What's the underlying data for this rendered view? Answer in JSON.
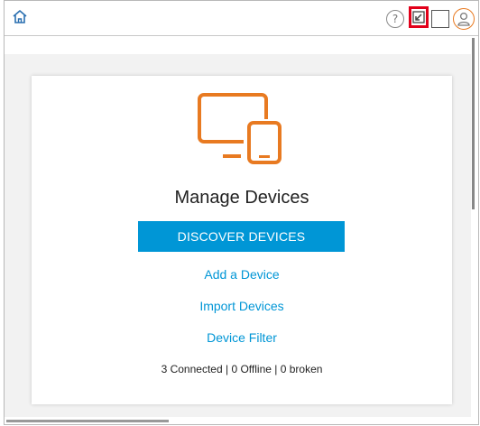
{
  "titlebar": {
    "home_icon": "home-icon",
    "help_label": "?",
    "popout_icon": "popout-icon",
    "window_icon": "window-icon",
    "user_icon": "user-icon",
    "accent_color": "#e87a21",
    "highlight_color": "#e2001a"
  },
  "card": {
    "illustration_icon": "devices-icon",
    "illustration_color": "#e87a21",
    "title": "Manage Devices",
    "primary_button": "DISCOVER DEVICES",
    "primary_color": "#0096d6",
    "links": {
      "add": "Add a Device",
      "import": "Import Devices",
      "filter": "Device Filter"
    },
    "status": {
      "connected": "3 Connected",
      "offline": "0 Offline",
      "broken": "0 broken",
      "separator": " | "
    }
  }
}
